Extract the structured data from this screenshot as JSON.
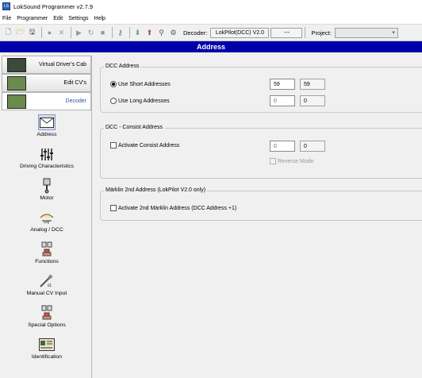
{
  "window": {
    "title": "LokSound Programmer  v2.7.9",
    "icon": "loksound-app-icon"
  },
  "menu": [
    "File",
    "Programmer",
    "Edit",
    "Settings",
    "Help"
  ],
  "toolbar": {
    "decoder_label": "Decoder:",
    "decoder_value": "LokPilot(DCC) V2.0",
    "decoder_extra": "---",
    "project_label": "Project:",
    "project_value": ""
  },
  "header": {
    "title": "Address"
  },
  "nav_buttons": [
    {
      "label": "Virtual Driver's Cab",
      "thumb": "cab-thumbnail"
    },
    {
      "label": "Edit CV's",
      "thumb": "cv-grid-thumbnail"
    },
    {
      "label": "Decoder",
      "thumb": "decoder-thumbnail",
      "active": true
    }
  ],
  "categories": [
    {
      "label": "Address",
      "icon": "envelope-icon",
      "active": true
    },
    {
      "label": "Driving Characteristics",
      "icon": "sliders-icon"
    },
    {
      "label": "Motor",
      "icon": "motor-piston-icon"
    },
    {
      "label": "Analog / DCC",
      "icon": "analog-dcc-icon"
    },
    {
      "label": "Functions",
      "icon": "functions-icon"
    },
    {
      "label": "Manual CV Input",
      "icon": "manual-cv-icon"
    },
    {
      "label": "Special Options",
      "icon": "special-options-icon"
    },
    {
      "label": "Identification",
      "icon": "id-card-icon"
    }
  ],
  "dcc_address": {
    "title": "DCC Address",
    "short_label": "Use Short Addresses",
    "short_selected": true,
    "short_value": "59",
    "short_readout": "59",
    "long_label": "Use Long Addresses",
    "long_value": "0",
    "long_readout": "0"
  },
  "consist": {
    "title": "DCC - Consist Address",
    "activate_label": "Activate Consist Address",
    "value": "0",
    "readout": "0",
    "reverse_label": "Reverse Mode"
  },
  "marklin": {
    "title": "Märklin 2nd Address (LokPilot V2.0 only)",
    "activate_label": "Activate 2nd Märklin Address (DCC Address +1)"
  }
}
